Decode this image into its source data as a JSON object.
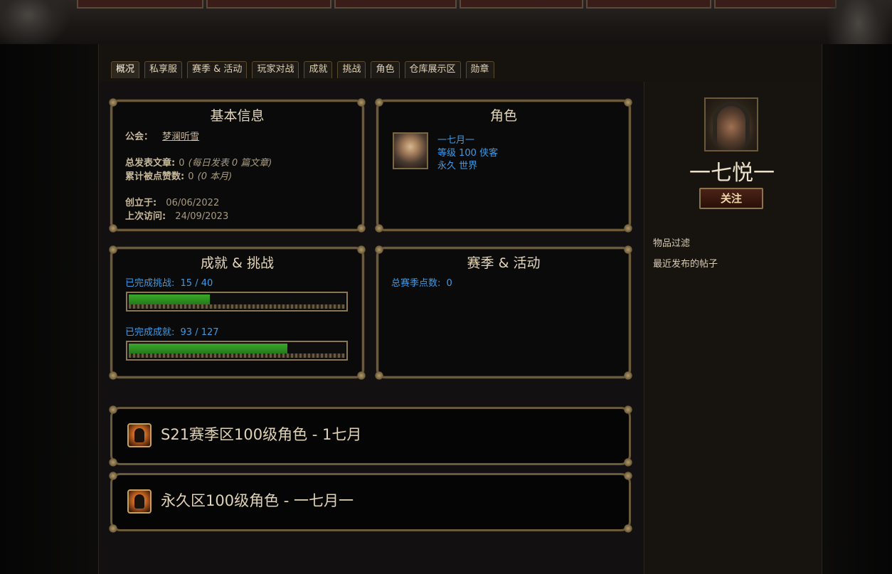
{
  "tabs": [
    "概况",
    "私享服",
    "赛季 & 活动",
    "玩家对战",
    "成就",
    "挑战",
    "角色",
    "仓库展示区",
    "勋章"
  ],
  "basic_info": {
    "title": "基本信息",
    "clan_label": "公会：",
    "clan_value": "梦澜听雪",
    "posts_label": "总发表文章:",
    "posts_value": "0",
    "posts_rate": "(每日发表 0 篇文章)",
    "likes_label": "累计被点赞数:",
    "likes_value": "0",
    "likes_month": "(0 本月)",
    "created_label": "创立于:",
    "created_value": "06/06/2022",
    "last_visit_label": "上次访问:",
    "last_visit_value": "24/09/2023"
  },
  "character": {
    "title": "角色",
    "name": "一七月一",
    "level_class": "等级 100 侠客",
    "realm": "永久 世界"
  },
  "achievements": {
    "title": "成就 & 挑战",
    "challenges_label": "已完成挑战:",
    "challenges_value": "15 / 40",
    "challenges_done": 15,
    "challenges_total": 40,
    "achievements_label": "已完成成就:",
    "achievements_value": "93 / 127",
    "achievements_done": 93,
    "achievements_total": 127
  },
  "season": {
    "title": "赛季 & 活动",
    "points_label": "总赛季点数:",
    "points_value": "0"
  },
  "banners": [
    {
      "title": "S21赛季区100级角色 - 1七月"
    },
    {
      "title": "永久区100级角色 - 一七月一"
    }
  ],
  "profile": {
    "username": "一七悦一",
    "follow_label": "关注",
    "links": [
      "物品过滤",
      "最近发布的帖子"
    ]
  },
  "colors": {
    "accent_blue": "#3d9be6",
    "progress_green": "#2f9621",
    "frame_gold": "#6b5a3a"
  }
}
